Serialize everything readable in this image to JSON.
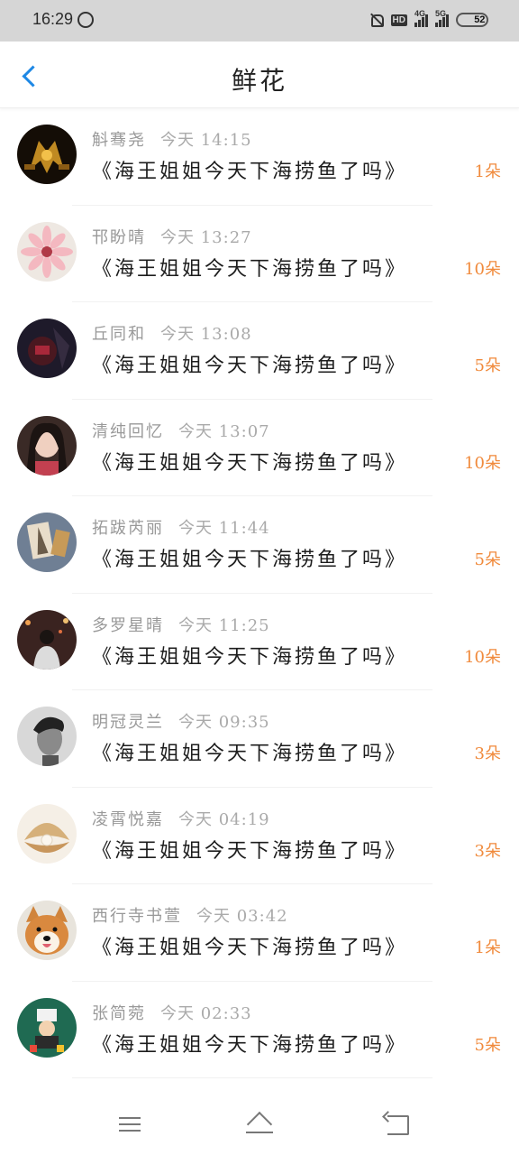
{
  "status_bar": {
    "time": "16:29",
    "battery": "52",
    "battery_level_percent": 52,
    "hd_label": "HD",
    "net1": "4G",
    "net2": "5G"
  },
  "header": {
    "title": "鲜花"
  },
  "colors": {
    "accent_blue": "#1e88e5",
    "count_orange": "#f08a3c"
  },
  "items": [
    {
      "name": "斛骞尧",
      "time": "今天 14:15",
      "content": "《海王姐姐今天下海捞鱼了吗》",
      "count": "1朵",
      "avatar_icon": "dark-mech-avatar"
    },
    {
      "name": "邗盼晴",
      "time": "今天 13:27",
      "content": "《海王姐姐今天下海捞鱼了吗》",
      "count": "10朵",
      "avatar_icon": "pink-flower-avatar"
    },
    {
      "name": "丘同和",
      "time": "今天 13:08",
      "content": "《海王姐姐今天下海捞鱼了吗》",
      "count": "5朵",
      "avatar_icon": "dark-red-scene-avatar"
    },
    {
      "name": "清纯回忆",
      "time": "今天 13:07",
      "content": "《海王姐姐今天下海捞鱼了吗》",
      "count": "10朵",
      "avatar_icon": "doll-girl-avatar"
    },
    {
      "name": "拓跋芮丽",
      "time": "今天 11:44",
      "content": "《海王姐姐今天下海捞鱼了吗》",
      "count": "5朵",
      "avatar_icon": "eiffel-card-avatar"
    },
    {
      "name": "多罗星晴",
      "time": "今天 11:25",
      "content": "《海王姐姐今天下海捞鱼了吗》",
      "count": "10朵",
      "avatar_icon": "night-street-person-avatar"
    },
    {
      "name": "明冠灵兰",
      "time": "今天 09:35",
      "content": "《海王姐姐今天下海捞鱼了吗》",
      "count": "3朵",
      "avatar_icon": "bw-portrait-avatar"
    },
    {
      "name": "凌霄悦嘉",
      "time": "今天 04:19",
      "content": "《海王姐姐今天下海捞鱼了吗》",
      "count": "3朵",
      "avatar_icon": "pearl-shell-avatar"
    },
    {
      "name": "西行寺书萱",
      "time": "今天 03:42",
      "content": "《海王姐姐今天下海捞鱼了吗》",
      "count": "1朵",
      "avatar_icon": "shiba-dog-avatar"
    },
    {
      "name": "张简菀",
      "time": "今天 02:33",
      "content": "《海王姐姐今天下海捞鱼了吗》",
      "count": "5朵",
      "avatar_icon": "green-cartoon-avatar"
    }
  ],
  "nav": {
    "menu_icon": "menu-icon",
    "home_icon": "home-icon",
    "back_icon": "back-icon"
  }
}
